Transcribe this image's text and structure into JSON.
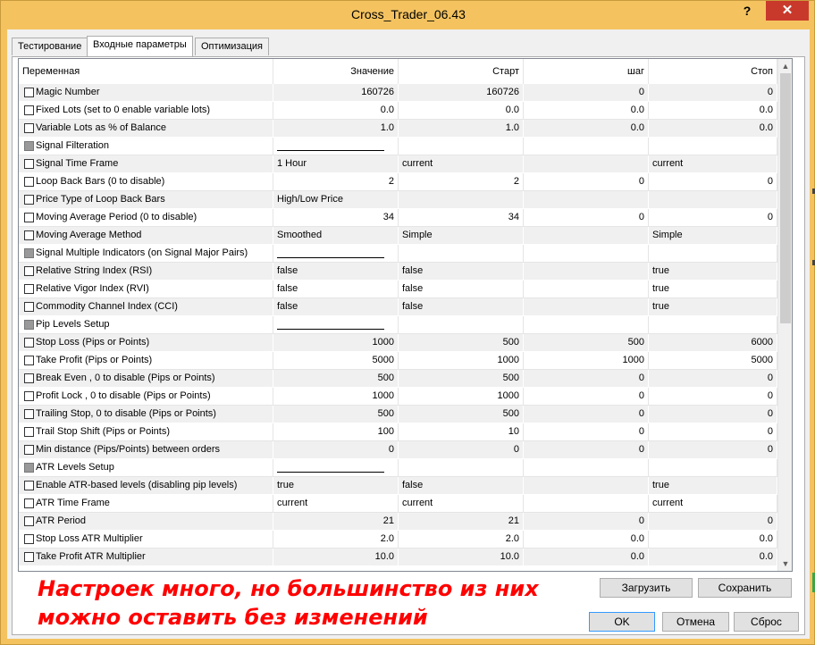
{
  "window": {
    "title": "Cross_Trader_06.43",
    "help": "?",
    "close": "✕"
  },
  "tabs": [
    "Тестирование",
    "Входные параметры",
    "Оптимизация"
  ],
  "table": {
    "headers": [
      "Переменная",
      "Значение",
      "Старт",
      "шаг",
      "Стоп"
    ],
    "rows": [
      {
        "name": "Magic Number",
        "value": "160726",
        "start": "160726",
        "step": "0",
        "stop": "0"
      },
      {
        "name": "Fixed Lots (set to 0 enable variable lots)",
        "value": "0.0",
        "start": "0.0",
        "step": "0.0",
        "stop": "0.0"
      },
      {
        "name": "Variable Lots as % of Balance",
        "value": "1.0",
        "start": "1.0",
        "step": "0.0",
        "stop": "0.0"
      },
      {
        "name": "Signal Filteration",
        "value": "",
        "start": "",
        "step": "",
        "stop": ""
      },
      {
        "name": "Signal Time Frame",
        "value": "1 Hour",
        "start": "current",
        "step": "",
        "stop": "current"
      },
      {
        "name": "Loop Back Bars (0 to disable)",
        "value": "2",
        "start": "2",
        "step": "0",
        "stop": "0"
      },
      {
        "name": "Price Type of Loop Back Bars",
        "value": "High/Low Price",
        "start": "",
        "step": "",
        "stop": ""
      },
      {
        "name": "Moving Average Period (0 to disable)",
        "value": "34",
        "start": "34",
        "step": "0",
        "stop": "0"
      },
      {
        "name": "Moving Average Method",
        "value": "Smoothed",
        "start": "Simple",
        "step": "",
        "stop": "Simple"
      },
      {
        "name": "Signal Multiple Indicators (on Signal Major Pairs)",
        "value": "",
        "start": "",
        "step": "",
        "stop": ""
      },
      {
        "name": "Relative String Index (RSI)",
        "value": "false",
        "start": "false",
        "step": "",
        "stop": "true"
      },
      {
        "name": "Relative Vigor Index (RVI)",
        "value": "false",
        "start": "false",
        "step": "",
        "stop": "true"
      },
      {
        "name": "Commodity Channel Index (CCI)",
        "value": "false",
        "start": "false",
        "step": "",
        "stop": "true"
      },
      {
        "name": "Pip Levels Setup",
        "value": "",
        "start": "",
        "step": "",
        "stop": ""
      },
      {
        "name": "Stop Loss (Pips or Points)",
        "value": "1000",
        "start": "500",
        "step": "500",
        "stop": "6000"
      },
      {
        "name": "Take Profit (Pips or Points)",
        "value": "5000",
        "start": "1000",
        "step": "1000",
        "stop": "5000"
      },
      {
        "name": "Break Even , 0 to disable (Pips or Points)",
        "value": "500",
        "start": "500",
        "step": "0",
        "stop": "0"
      },
      {
        "name": "Profit Lock , 0 to disable (Pips or Points)",
        "value": "1000",
        "start": "1000",
        "step": "0",
        "stop": "0"
      },
      {
        "name": "Trailing Stop, 0 to disable (Pips or Points)",
        "value": "500",
        "start": "500",
        "step": "0",
        "stop": "0"
      },
      {
        "name": "Trail Stop Shift (Pips or Points)",
        "value": "100",
        "start": "10",
        "step": "0",
        "stop": "0"
      },
      {
        "name": "Min distance (Pips/Points) between orders",
        "value": "0",
        "start": "0",
        "step": "0",
        "stop": "0"
      },
      {
        "name": "ATR Levels Setup",
        "value": "",
        "start": "",
        "step": "",
        "stop": ""
      },
      {
        "name": "Enable ATR-based levels (disabling pip levels)",
        "value": "true",
        "start": "false",
        "step": "",
        "stop": "true"
      },
      {
        "name": "ATR Time Frame",
        "value": "current",
        "start": "current",
        "step": "",
        "stop": "current"
      },
      {
        "name": "ATR Period",
        "value": "21",
        "start": "21",
        "step": "0",
        "stop": "0"
      },
      {
        "name": "Stop Loss ATR Multiplier",
        "value": "2.0",
        "start": "2.0",
        "step": "0.0",
        "stop": "0.0"
      },
      {
        "name": "Take Profit ATR Multiplier",
        "value": "10.0",
        "start": "10.0",
        "step": "0.0",
        "stop": "0.0"
      }
    ]
  },
  "buttons": {
    "load": "Загрузить",
    "save": "Сохранить",
    "ok": "OK",
    "cancel": "Отмена",
    "reset": "Сброс"
  },
  "annotation": {
    "line1": "Настроек много, но большинство из них",
    "line2": "можно оставить без изменений"
  },
  "colors": {
    "accent": "#3399ff",
    "annotation": "#ff0000",
    "close": "#c9392b",
    "frame": "#f4c360"
  }
}
